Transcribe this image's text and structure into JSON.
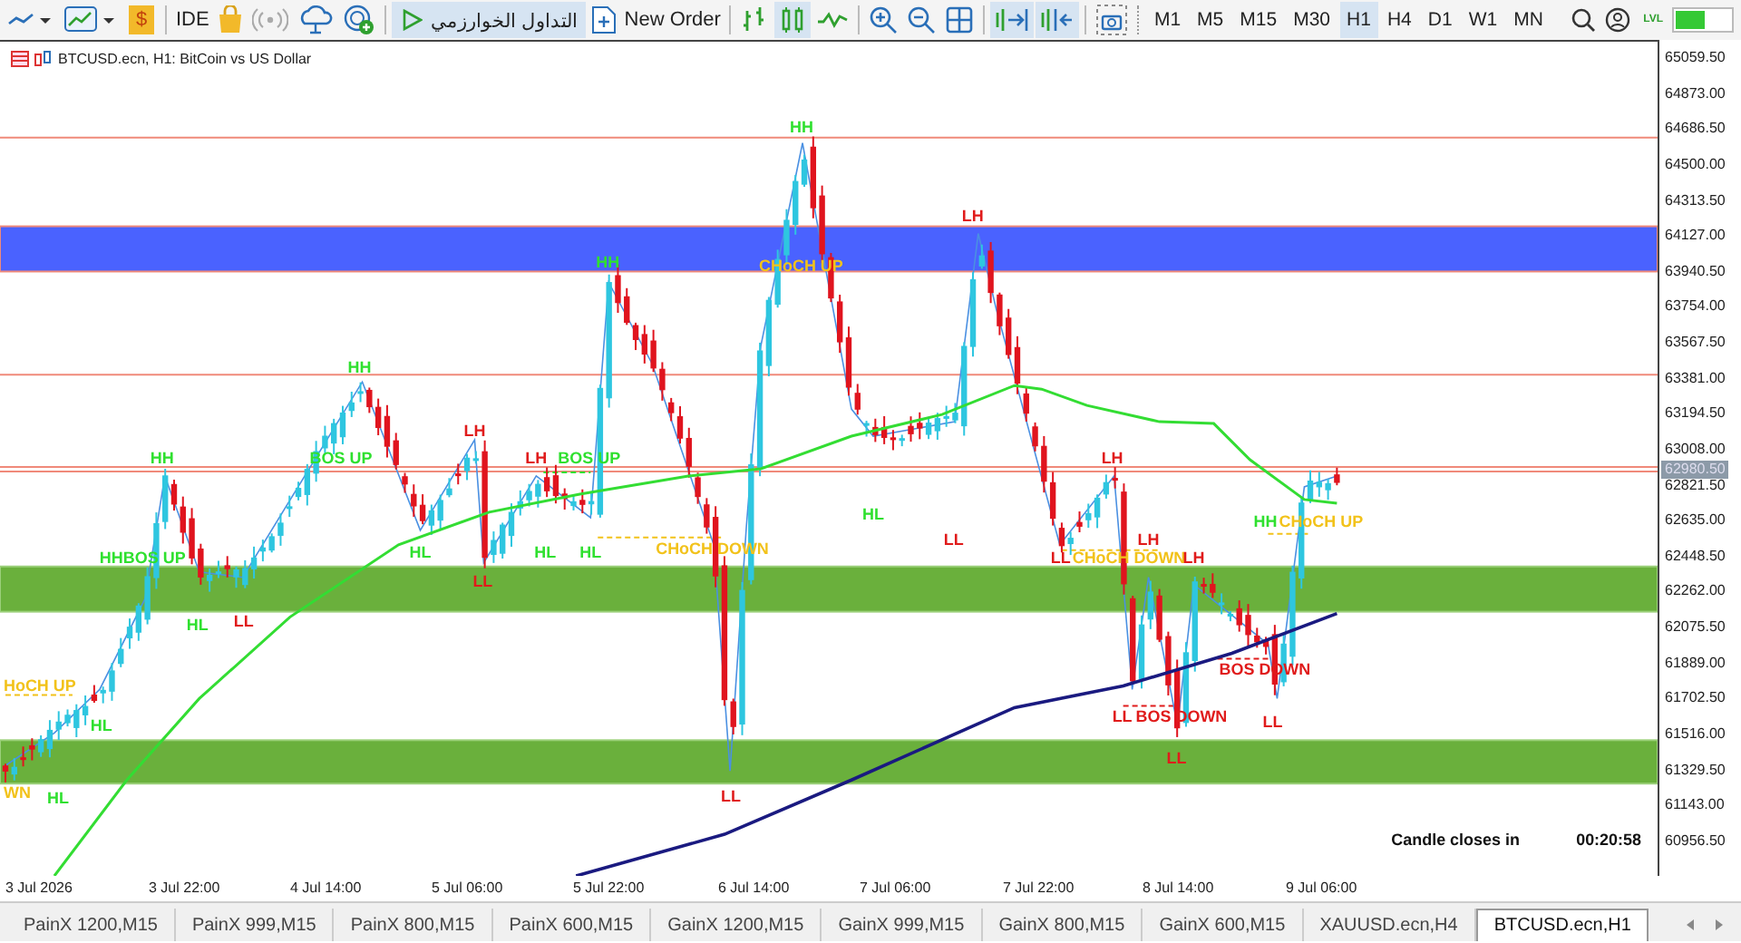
{
  "toolbar": {
    "wallet_symbol": "$",
    "ide": "IDE",
    "algo_trading": {
      "label": "التداول الخوارزمي",
      "selected": true
    },
    "new_order": "New Order",
    "chart_types": [
      {
        "selected": false
      },
      {
        "selected": true
      },
      {
        "selected": false
      }
    ],
    "autoscroll": {
      "selected": true
    },
    "chart_shift": {
      "selected": true
    },
    "timeframes": [
      {
        "label": "M1",
        "selected": false
      },
      {
        "label": "M5",
        "selected": false
      },
      {
        "label": "M15",
        "selected": false
      },
      {
        "label": "M30",
        "selected": false
      },
      {
        "label": "H1",
        "selected": true
      },
      {
        "label": "H4",
        "selected": false
      },
      {
        "label": "D1",
        "selected": false
      },
      {
        "label": "W1",
        "selected": false
      },
      {
        "label": "MN",
        "selected": false
      }
    ],
    "lvl": "LVL"
  },
  "chart": {
    "title": "BTCUSD.ecn, H1:  BitCoin vs US Dollar",
    "price_axis": [
      "65059.50",
      "64873.00",
      "64686.50",
      "64500.00",
      "64313.50",
      "64127.00",
      "63940.50",
      "63754.00",
      "63567.50",
      "63381.00",
      "63194.50",
      "63008.00",
      "62821.50",
      "62635.00",
      "62448.50",
      "62262.00",
      "62075.50",
      "61889.00",
      "61702.50",
      "61516.00",
      "61329.50",
      "61143.00",
      "60956.50"
    ],
    "current_price": "62980.50",
    "time_axis": [
      "3 Jul 2026",
      "3 Jul 22:00",
      "4 Jul 14:00",
      "5 Jul 06:00",
      "5 Jul 22:00",
      "6 Jul 14:00",
      "7 Jul 06:00",
      "7 Jul 22:00",
      "8 Jul 14:00",
      "9 Jul 06:00"
    ],
    "labels": [
      {
        "text": "HH",
        "color": "#2fe02f"
      },
      {
        "text": "LH",
        "color": "#e01b1b"
      },
      {
        "text": "HH",
        "color": "#2fe02f"
      },
      {
        "text": "CHoCH UP",
        "color": "#f2c21a"
      },
      {
        "text": "HH",
        "color": "#2fe02f"
      },
      {
        "text": "LH",
        "color": "#e01b1b"
      },
      {
        "text": "HH",
        "color": "#2fe02f"
      },
      {
        "text": "BOS UP",
        "color": "#2fe02f"
      },
      {
        "text": "LH",
        "color": "#e01b1b"
      },
      {
        "text": "BOS UP",
        "color": "#2fe02f"
      },
      {
        "text": "LH",
        "color": "#e01b1b"
      },
      {
        "text": "HL",
        "color": "#2fe02f"
      },
      {
        "text": "HH",
        "color": "#2fe02f"
      },
      {
        "text": "CHoCH UP",
        "color": "#f2c21a"
      },
      {
        "text": "LL",
        "color": "#e01b1b"
      },
      {
        "text": "HL",
        "color": "#2fe02f"
      },
      {
        "text": "HL",
        "color": "#2fe02f"
      },
      {
        "text": "HL",
        "color": "#2fe02f"
      },
      {
        "text": "CHoCH DOWN",
        "color": "#f2c21a"
      },
      {
        "text": "LH",
        "color": "#e01b1b"
      },
      {
        "text": "HHBOS UP",
        "color": "#2fe02f"
      },
      {
        "text": "LL",
        "color": "#e01b1b"
      },
      {
        "text": "CHoCH DOWN",
        "color": "#f2c21a"
      },
      {
        "text": "LH",
        "color": "#e01b1b"
      },
      {
        "text": "LL",
        "color": "#e01b1b"
      },
      {
        "text": "HL",
        "color": "#2fe02f"
      },
      {
        "text": "LL",
        "color": "#e01b1b"
      },
      {
        "text": "BOS DOWN",
        "color": "#e01b1b"
      },
      {
        "text": "HoCH UP",
        "color": "#f2c21a"
      },
      {
        "text": "LL",
        "color": "#e01b1b"
      },
      {
        "text": "BOS DOWN",
        "color": "#e01b1b"
      },
      {
        "text": "HL",
        "color": "#2fe02f"
      },
      {
        "text": "LL",
        "color": "#e01b1b"
      },
      {
        "text": "LL",
        "color": "#e01b1b"
      },
      {
        "text": "WN",
        "color": "#f2c21a"
      },
      {
        "text": "HL",
        "color": "#2fe02f"
      },
      {
        "text": "LL",
        "color": "#e01b1b"
      }
    ],
    "countdown_label": "Candle closes in",
    "countdown": "00:20:58"
  },
  "tabs": [
    {
      "label": "PainX 1200,M15",
      "selected": false
    },
    {
      "label": "PainX 999,M15",
      "selected": false
    },
    {
      "label": "PainX 800,M15",
      "selected": false
    },
    {
      "label": "PainX 600,M15",
      "selected": false
    },
    {
      "label": "GainX 1200,M15",
      "selected": false
    },
    {
      "label": "GainX 999,M15",
      "selected": false
    },
    {
      "label": "GainX 800,M15",
      "selected": false
    },
    {
      "label": "GainX 600,M15",
      "selected": false
    },
    {
      "label": "XAUUSD.ecn,H4",
      "selected": false
    },
    {
      "label": "BTCUSD.ecn,H1",
      "selected": true
    }
  ]
}
